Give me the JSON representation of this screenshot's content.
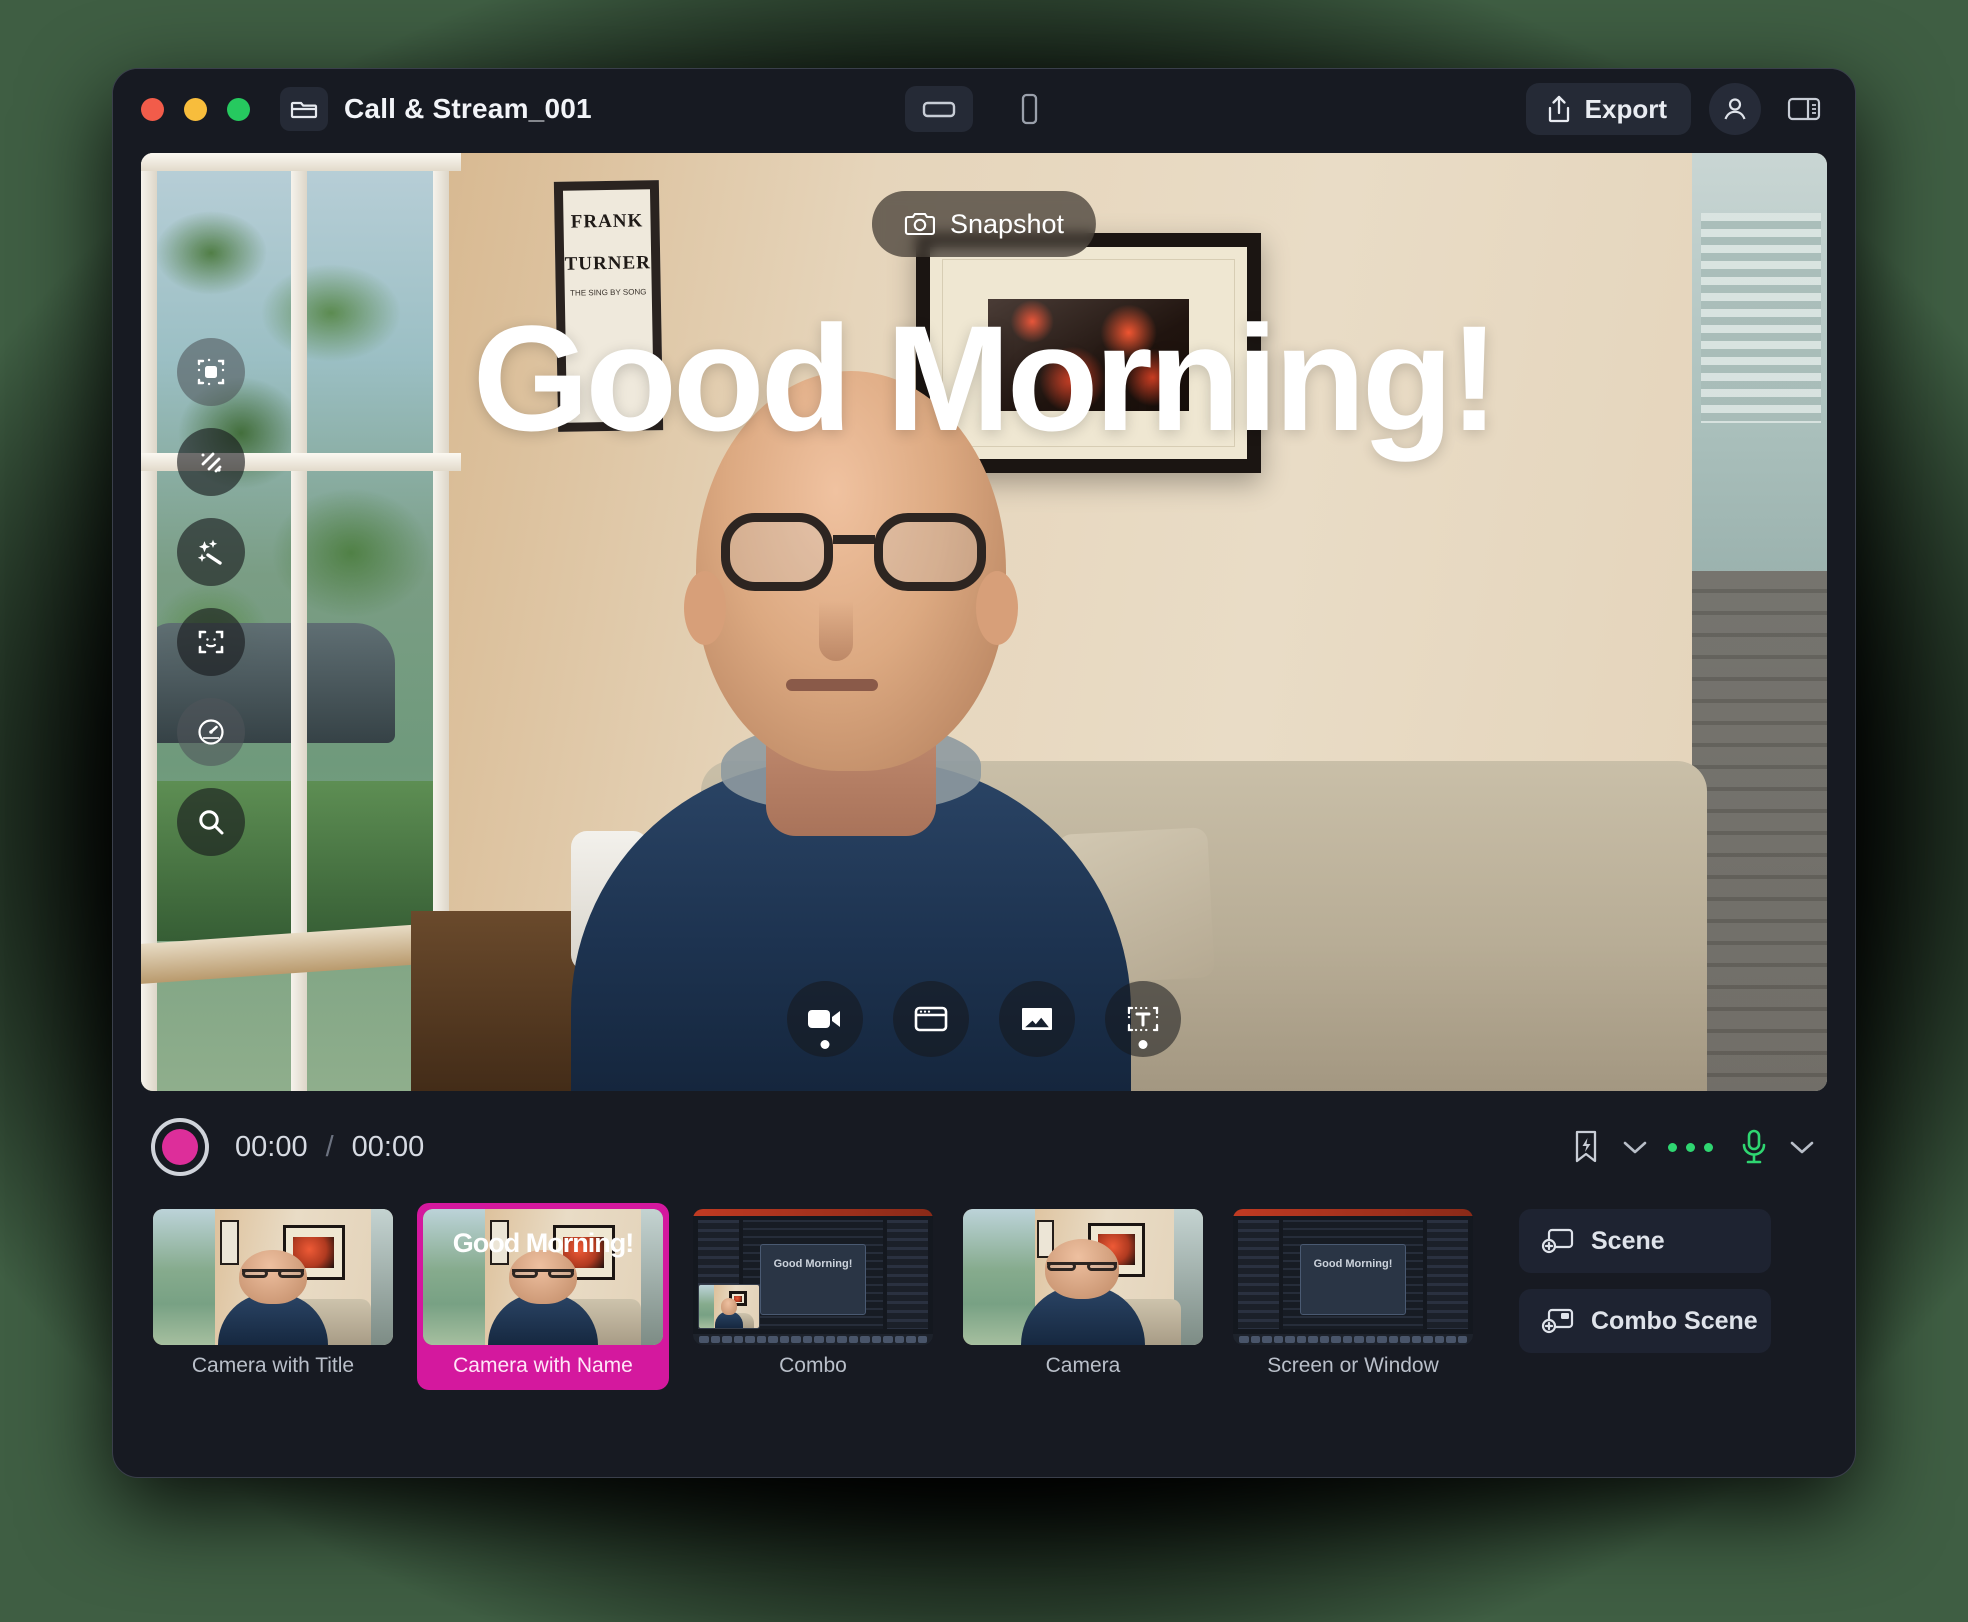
{
  "window": {
    "title": "Call & Stream_001",
    "traffic_lights": [
      "close",
      "minimize",
      "zoom"
    ],
    "folder_icon": "folder-icon",
    "orientation": {
      "landscape": "landscape-icon",
      "portrait": "portrait-icon",
      "selected": "landscape"
    },
    "export_label": "Export",
    "export_icon": "share-up-icon",
    "avatar_icon": "person-icon",
    "panel_icon": "sidebar-panel-icon"
  },
  "stage": {
    "overlay_title": "Good Morning!",
    "snapshot_label": "Snapshot",
    "snapshot_icon": "camera-icon",
    "left_tools": [
      {
        "name": "crop-frame-icon",
        "label": "Crop"
      },
      {
        "name": "background-blur-icon",
        "label": "Background"
      },
      {
        "name": "magic-wand-icon",
        "label": "Effects"
      },
      {
        "name": "face-tracking-icon",
        "label": "Tracking"
      },
      {
        "name": "speedometer-icon",
        "label": "Presets"
      },
      {
        "name": "search-icon",
        "label": "Zoom"
      }
    ],
    "sources": [
      {
        "name": "camera-source-icon",
        "label": "Camera",
        "active": true
      },
      {
        "name": "window-source-icon",
        "label": "Screen",
        "active": false
      },
      {
        "name": "image-source-icon",
        "label": "Image",
        "active": false
      },
      {
        "name": "text-source-icon",
        "label": "Text",
        "active": true
      }
    ]
  },
  "transport": {
    "record_icon": "record-button",
    "record_color": "#dd2e9a",
    "elapsed": "00:00",
    "separator": "/",
    "total": "00:00",
    "bookmark_icon": "bookmark-bolt-icon",
    "bookmark_chevron": "chevron-down-icon",
    "more_icon": "audio-level-dots",
    "mic_icon": "microphone-icon",
    "mic_color": "#2fd671",
    "mic_chevron": "chevron-down-icon"
  },
  "scenes": {
    "items": [
      {
        "label": "Camera with Title",
        "kind": "camera",
        "selected": false,
        "overlay": ""
      },
      {
        "label": "Camera with Name",
        "kind": "camera",
        "selected": true,
        "overlay": "Good Morning!"
      },
      {
        "label": "Combo",
        "kind": "screen-pip",
        "selected": false,
        "overlay": "Good Morning!"
      },
      {
        "label": "Camera",
        "kind": "camera-plain",
        "selected": false,
        "overlay": ""
      },
      {
        "label": "Screen or Window",
        "kind": "screen",
        "selected": false,
        "overlay": "Good Morning!"
      }
    ],
    "selected_color": "#d4189e",
    "actions": [
      {
        "label": "Scene",
        "icon": "add-scene-icon"
      },
      {
        "label": "Combo Scene",
        "icon": "add-combo-scene-icon"
      }
    ]
  },
  "scene_photo": {
    "poster_line1": "FRANK",
    "poster_line2": "TURNER",
    "poster_sub": "THE SING BY SONG"
  }
}
